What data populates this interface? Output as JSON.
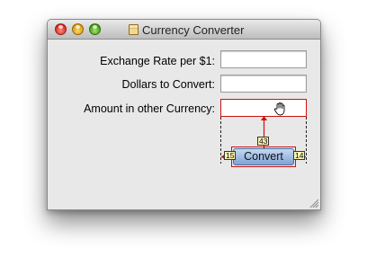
{
  "window": {
    "title": "Currency Converter",
    "title_icon": "document-icon"
  },
  "form": {
    "rate_label": "Exchange Rate per $1:",
    "rate_value": "",
    "dollars_label": "Dollars to Convert:",
    "dollars_value": "",
    "amount_label": "Amount in other Currency:",
    "amount_value": ""
  },
  "convert_button": {
    "label": "Convert"
  },
  "layout_guides": {
    "vertical_distance": "43",
    "left_distance": "15",
    "right_distance": "14"
  },
  "cursor": {
    "icon": "open-hand-icon"
  },
  "colors": {
    "guide": "#cc1111",
    "badge_bg": "#fff7b3",
    "button_blue": "#7ea3d6"
  }
}
